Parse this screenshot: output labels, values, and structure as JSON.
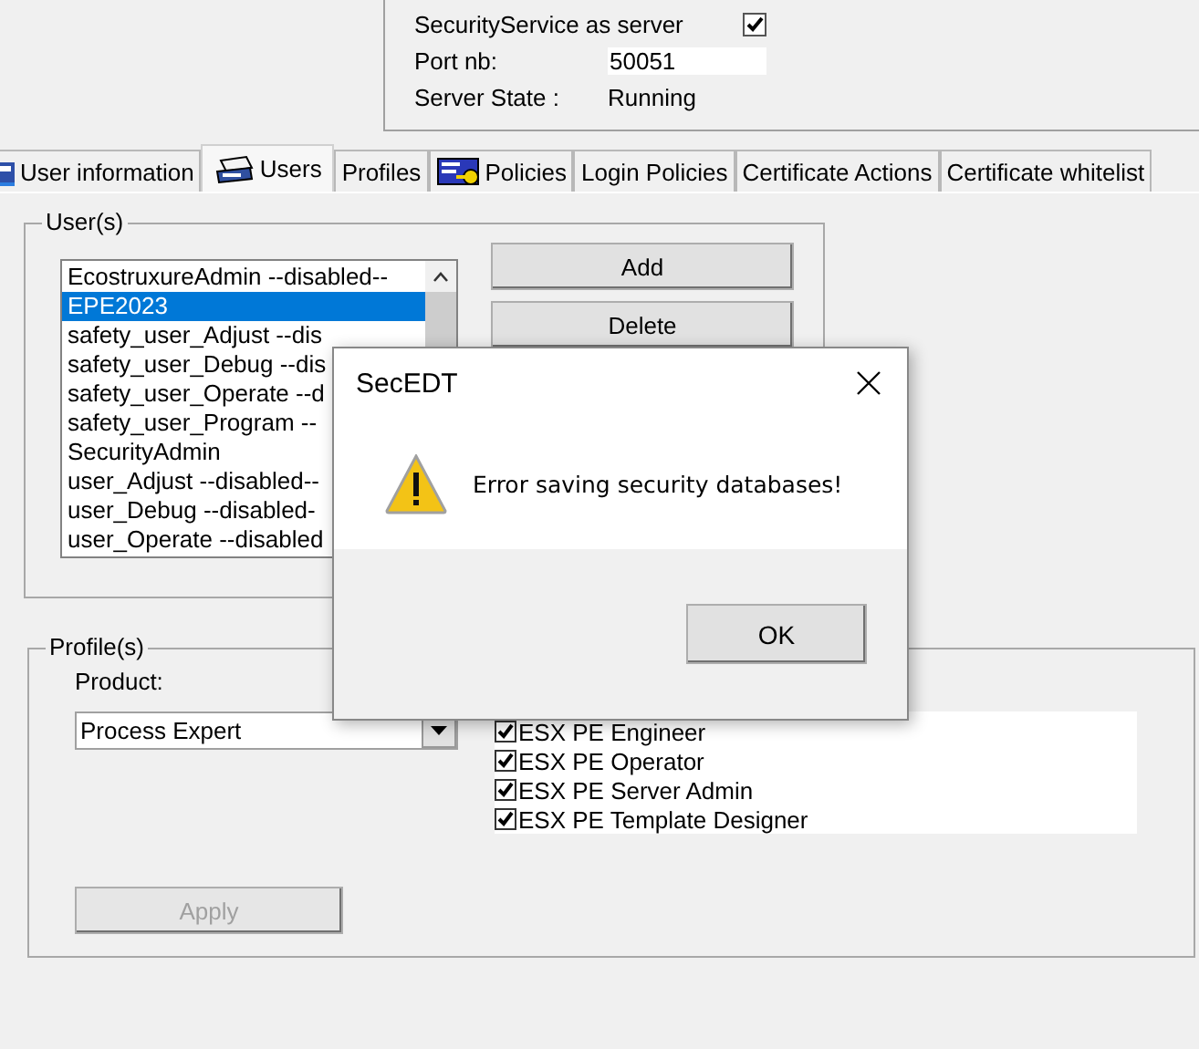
{
  "server": {
    "as_server_label": "SecurityService as server",
    "as_server_checked": true,
    "port_label": "Port nb:",
    "port_value": "50051",
    "state_label": "Server State :",
    "state_value": "Running"
  },
  "tabs": [
    {
      "label": "User information",
      "selected": false
    },
    {
      "label": "Users",
      "selected": true
    },
    {
      "label": "Profiles",
      "selected": false
    },
    {
      "label": "Policies",
      "selected": false
    },
    {
      "label": "Login Policies",
      "selected": false
    },
    {
      "label": "Certificate Actions",
      "selected": false
    },
    {
      "label": "Certificate whitelist",
      "selected": false
    }
  ],
  "users": {
    "title": "User(s)",
    "items": [
      {
        "text": "EcostruxureAdmin  --disabled--",
        "selected": false
      },
      {
        "text": "EPE2023",
        "selected": true
      },
      {
        "text": "safety_user_Adjust --dis",
        "selected": false
      },
      {
        "text": "safety_user_Debug --dis",
        "selected": false
      },
      {
        "text": "safety_user_Operate --d",
        "selected": false
      },
      {
        "text": "safety_user_Program --",
        "selected": false
      },
      {
        "text": "SecurityAdmin",
        "selected": false
      },
      {
        "text": "user_Adjust --disabled--",
        "selected": false
      },
      {
        "text": "user_Debug --disabled-",
        "selected": false
      },
      {
        "text": "user_Operate --disabled",
        "selected": false
      }
    ],
    "buttons": [
      "Add",
      "Delete"
    ]
  },
  "profiles": {
    "title": "Profile(s)",
    "product_label": "Product:",
    "product_value": "Process Expert",
    "items": [
      {
        "text": "ESX PE Engineer",
        "checked": true
      },
      {
        "text": "ESX PE Operator",
        "checked": true
      },
      {
        "text": "ESX PE Server Admin",
        "checked": true
      },
      {
        "text": "ESX PE Template Designer",
        "checked": true
      }
    ],
    "apply": {
      "label": "Apply",
      "disabled": true
    }
  },
  "dialog": {
    "title": "SecEDT",
    "message": "Error saving security databases!",
    "button": "OK"
  }
}
